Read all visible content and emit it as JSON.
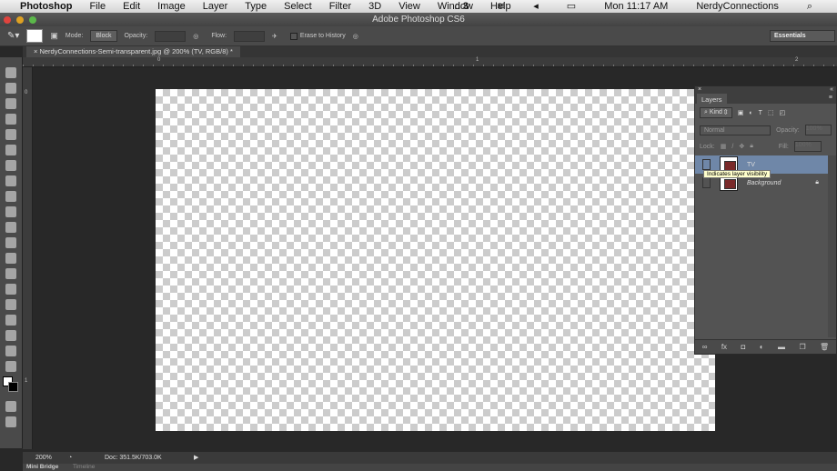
{
  "menubar": {
    "app": "Photoshop",
    "items": [
      "File",
      "Edit",
      "Image",
      "Layer",
      "Type",
      "Select",
      "Filter",
      "3D",
      "View",
      "Window",
      "Help"
    ],
    "adobe_count": "3",
    "clock": "Mon 11:17 AM",
    "user": "NerdyConnections"
  },
  "window": {
    "title": "Adobe Photoshop CS6"
  },
  "options": {
    "mode_label": "Mode:",
    "mode_value": "Block",
    "opacity_label": "Opacity:",
    "flow_label": "Flow:",
    "erase_history": "Erase to History",
    "workspace": "Essentials"
  },
  "document": {
    "tab": "NerdyConnections-Semi-transparent.jpg @ 200% (TV, RGB/8) *",
    "ruler_h": [
      "0",
      "1",
      "2"
    ],
    "ruler_v": [
      "0",
      "1"
    ]
  },
  "status": {
    "zoom": "200%",
    "doc": "Doc: 351.5K/703.0K"
  },
  "bottom_tabs": [
    "Mini Bridge",
    "Timeline"
  ],
  "layers_panel": {
    "title": "Layers",
    "filter": "Kind",
    "blend": "Normal",
    "opacity_label": "Opacity:",
    "opacity": "100%",
    "lock_label": "Lock:",
    "fill_label": "Fill:",
    "fill": "100%",
    "layers": [
      {
        "name": "TV",
        "selected": true
      },
      {
        "name": "Background",
        "locked": true
      }
    ],
    "tooltip": "Indicates layer visibility"
  },
  "colors": {
    "selected_layer": "#6f87a8",
    "panel": "#535353"
  }
}
